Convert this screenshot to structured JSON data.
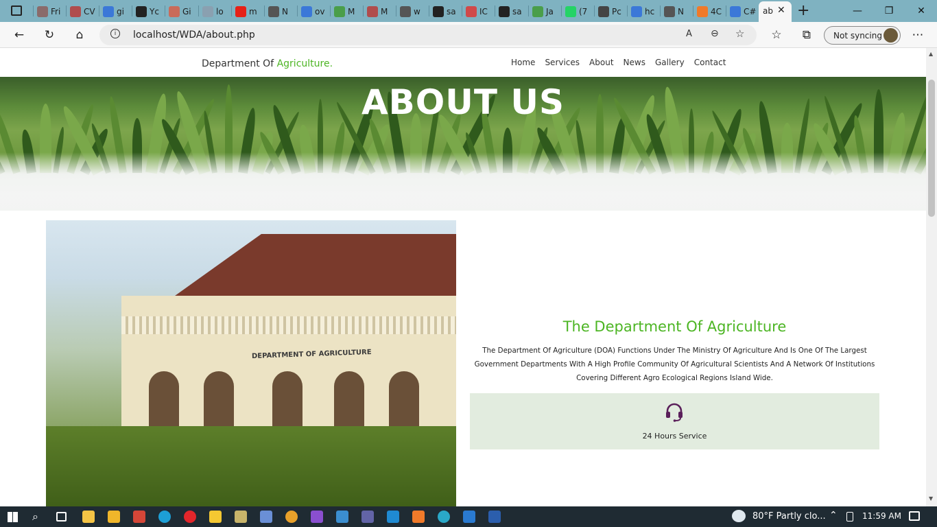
{
  "browser": {
    "tabs": [
      {
        "label": "Fri",
        "color": "#8a6b6b"
      },
      {
        "label": "CV",
        "color": "#b04d4d"
      },
      {
        "label": "gi",
        "color": "#3b78d8"
      },
      {
        "label": "Yc",
        "color": "#222222"
      },
      {
        "label": "Gi",
        "color": "#c96b5a"
      },
      {
        "label": "lo",
        "color": "#8aa0b0"
      },
      {
        "label": "m",
        "color": "#e62117"
      },
      {
        "label": "N",
        "color": "#555555"
      },
      {
        "label": "ov",
        "color": "#3b78d8"
      },
      {
        "label": "M",
        "color": "#4a9e4a"
      },
      {
        "label": "M",
        "color": "#b04d4d"
      },
      {
        "label": "w",
        "color": "#555555"
      },
      {
        "label": "sa",
        "color": "#222222"
      },
      {
        "label": "IC",
        "color": "#d04a4a"
      },
      {
        "label": "sa",
        "color": "#222222"
      },
      {
        "label": "Ja",
        "color": "#4a9e4a"
      },
      {
        "label": "(7",
        "color": "#25d366"
      },
      {
        "label": "Pc",
        "color": "#444444"
      },
      {
        "label": "hc",
        "color": "#3b78d8"
      },
      {
        "label": "N",
        "color": "#555555"
      },
      {
        "label": "4C",
        "color": "#f07a2a"
      },
      {
        "label": "C#",
        "color": "#3b78d8"
      }
    ],
    "active_tab": "ab",
    "url": "localhost/WDA/about.php",
    "sync_label": "Not syncing"
  },
  "site": {
    "brand_main": "Department Of ",
    "brand_highlight": "Agriculture.",
    "menu": [
      "Home",
      "Services",
      "About",
      "News",
      "Gallery",
      "Contact"
    ],
    "hero_title": "ABOUT US",
    "photo_sign": "DEPARTMENT OF AGRICULTURE",
    "about_title": "The Department Of Agriculture",
    "about_text": "The Department Of Agriculture (DOA) Functions Under The Ministry Of Agriculture And Is One Of The Largest Government Departments With A High Profile Community Of Agricultural Scientists And A Network Of Institutions Covering Different Agro Ecological Regions Island Wide.",
    "feature_label": "24 Hours Service",
    "feature_icon": "headset-icon",
    "colors": {
      "accent": "#4cb523",
      "feature_bg": "#e2ecdf",
      "icon": "#5a1f5a"
    }
  },
  "taskbar": {
    "weather": "80°F  Partly clo...",
    "time": "11:59 AM"
  }
}
